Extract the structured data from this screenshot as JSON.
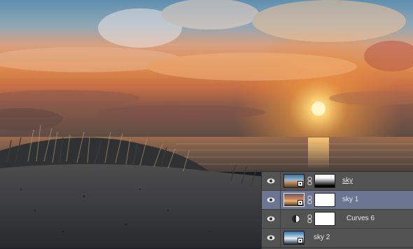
{
  "layers_panel": {
    "layers": [
      {
        "name": "sky",
        "visible": true,
        "selected": false,
        "kind": "image",
        "has_mask": true,
        "mask": "gradient"
      },
      {
        "name": "sky 1",
        "visible": true,
        "selected": true,
        "kind": "image",
        "has_mask": true,
        "mask": "white"
      },
      {
        "name": "Curves 6",
        "visible": true,
        "selected": false,
        "kind": "adjustment",
        "has_mask": true,
        "mask": "white"
      },
      {
        "name": "sky 2",
        "visible": true,
        "selected": false,
        "kind": "image",
        "has_mask": false
      }
    ]
  },
  "colors": {
    "panel_bg": "#535353",
    "selected_row": "#6b7591",
    "text": "#e8e8e8"
  },
  "icons": {
    "visibility": "eye-icon",
    "link": "chain-link-icon",
    "adjustment": "curves-adjustment-icon",
    "smart_object": "smart-object-badge-icon"
  }
}
